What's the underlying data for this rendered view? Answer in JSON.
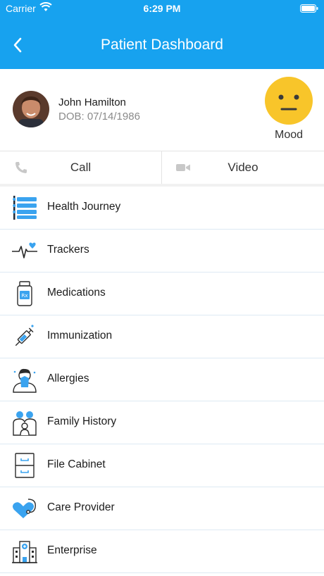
{
  "status_bar": {
    "carrier": "Carrier",
    "time": "6:29 PM"
  },
  "header": {
    "title": "Patient Dashboard",
    "back_icon": "chevron-left-icon"
  },
  "patient": {
    "name": "John Hamilton",
    "dob": "DOB: 07/14/1986"
  },
  "mood": {
    "label": "Mood",
    "icon": "neutral-face-icon"
  },
  "actions": {
    "call_label": "Call",
    "video_label": "Video"
  },
  "menu": [
    {
      "label": "Health Journey",
      "icon": "health-journey-icon"
    },
    {
      "label": "Trackers",
      "icon": "heartbeat-icon"
    },
    {
      "label": "Medications",
      "icon": "medication-bottle-icon"
    },
    {
      "label": "Immunization",
      "icon": "syringe-icon"
    },
    {
      "label": "Allergies",
      "icon": "allergy-person-icon"
    },
    {
      "label": "Family History",
      "icon": "family-icon"
    },
    {
      "label": "File Cabinet",
      "icon": "file-cabinet-icon"
    },
    {
      "label": "Care Provider",
      "icon": "stethoscope-heart-icon"
    },
    {
      "label": "Enterprise",
      "icon": "hospital-building-icon"
    }
  ],
  "colors": {
    "accent": "#17a2ef",
    "mood_yellow": "#f8c52a"
  }
}
